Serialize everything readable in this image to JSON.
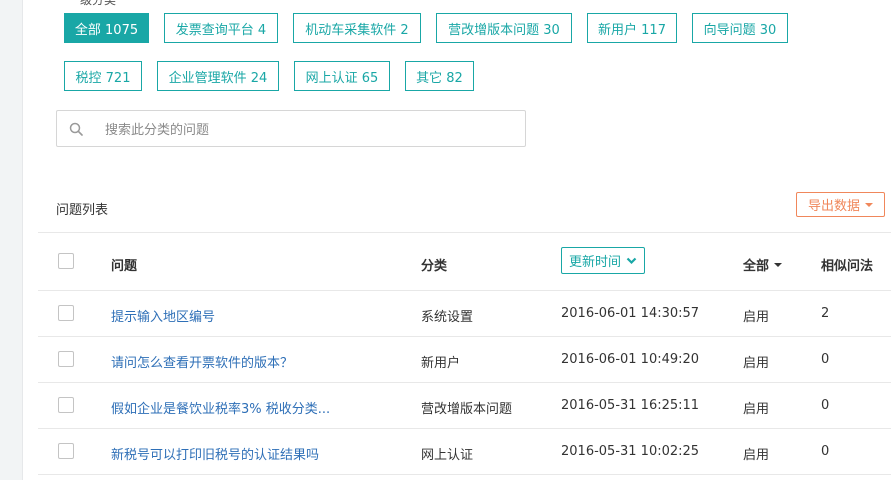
{
  "categories": {
    "label": "一级分类",
    "chips": [
      {
        "label": "全部 1075",
        "active": true
      },
      {
        "label": "发票查询平台 4"
      },
      {
        "label": "机动车采集软件 2"
      },
      {
        "label": "营改增版本问题 30"
      },
      {
        "label": "新用户 117"
      },
      {
        "label": "向导问题 30"
      },
      {
        "label": "税控 721"
      },
      {
        "label": "企业管理软件 24"
      },
      {
        "label": "网上认证 65"
      },
      {
        "label": "其它 82"
      }
    ]
  },
  "search": {
    "placeholder": "搜索此分类的问题",
    "value": ""
  },
  "list": {
    "title": "问题列表",
    "export_label": "导出数据"
  },
  "table": {
    "headers": {
      "question": "问题",
      "category": "分类",
      "updated": "更新时间",
      "status": "全部",
      "similar": "相似问法"
    },
    "rows": [
      {
        "question": "提示输入地区编号",
        "category": "系统设置",
        "updated": "2016-06-01 14:30:57",
        "status": "启用",
        "similar": "2"
      },
      {
        "question": "请问怎么查看开票软件的版本？",
        "category": "新用户",
        "updated": "2016-06-01 10:49:20",
        "status": "启用",
        "similar": "0"
      },
      {
        "question": "假如企业是餐饮业税率3% 税收分类...",
        "category": "营改增版本问题",
        "updated": "2016-05-31 16:25:11",
        "status": "启用",
        "similar": "0"
      },
      {
        "question": "新税号可以打印旧税号的认证结果吗",
        "category": "网上认证",
        "updated": "2016-05-31 10:02:25",
        "status": "启用",
        "similar": "0"
      }
    ]
  },
  "colors": {
    "accent": "#19a7a6",
    "link": "#2e6fb7",
    "export": "#f0875b"
  },
  "icons": {
    "search": "search-icon",
    "sort": "chevron-down-icon"
  }
}
